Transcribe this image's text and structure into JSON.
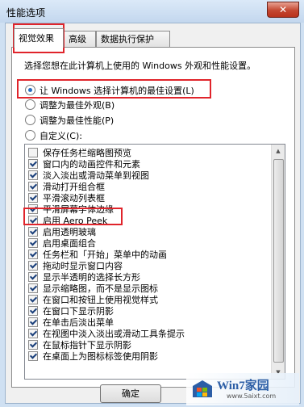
{
  "window": {
    "title": "性能选项",
    "close_glyph": "✕"
  },
  "tabs": [
    {
      "label": "视觉效果",
      "active": true
    },
    {
      "label": "高级",
      "active": false
    },
    {
      "label": "数据执行保护",
      "active": false
    }
  ],
  "description": "选择您想在此计算机上使用的 Windows 外观和性能设置。",
  "radios": [
    {
      "label": "让 Windows 选择计算机的最佳设置(L)",
      "checked": true
    },
    {
      "label": "调整为最佳外观(B)",
      "checked": false
    },
    {
      "label": "调整为最佳性能(P)",
      "checked": false
    },
    {
      "label": "自定义(C):",
      "checked": false
    }
  ],
  "effects": [
    {
      "label": "保存任务栏缩略图预览",
      "checked": false
    },
    {
      "label": "窗口内的动画控件和元素",
      "checked": true
    },
    {
      "label": "淡入淡出或滑动菜单到视图",
      "checked": true
    },
    {
      "label": "滑动打开组合框",
      "checked": true
    },
    {
      "label": "平滑滚动列表框",
      "checked": true
    },
    {
      "label": "平滑屏幕字体边缘",
      "checked": true
    },
    {
      "label": "启用 Aero Peek",
      "checked": true
    },
    {
      "label": "启用透明玻璃",
      "checked": true
    },
    {
      "label": "启用桌面组合",
      "checked": true
    },
    {
      "label": "任务栏和「开始」菜单中的动画",
      "checked": true
    },
    {
      "label": "拖动时显示窗口内容",
      "checked": true
    },
    {
      "label": "显示半透明的选择长方形",
      "checked": true
    },
    {
      "label": "显示缩略图，而不是显示图标",
      "checked": true
    },
    {
      "label": "在窗口和按钮上使用视觉样式",
      "checked": true
    },
    {
      "label": "在窗口下显示阴影",
      "checked": true
    },
    {
      "label": "在单击后淡出菜单",
      "checked": true
    },
    {
      "label": "在视图中淡入淡出或滑动工具条提示",
      "checked": true
    },
    {
      "label": "在鼠标指针下显示阴影",
      "checked": true
    },
    {
      "label": "在桌面上为图标标签使用阴影",
      "checked": true
    }
  ],
  "buttons": {
    "ok": "确定"
  },
  "watermark": {
    "brand": "Win7家园",
    "url": "www.5aixt.com"
  },
  "colors": {
    "highlight": "#e0242b",
    "accent": "#2a6ec2"
  }
}
